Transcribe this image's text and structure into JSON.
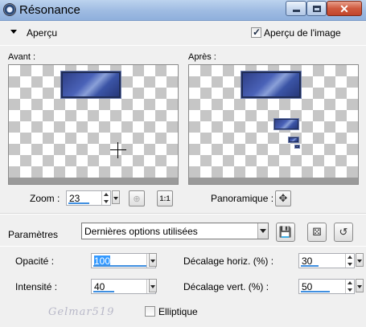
{
  "window": {
    "title": "Résonance"
  },
  "apercu": {
    "label": "Aperçu",
    "image_label": "Aperçu de l'image",
    "image_checked": true
  },
  "preview": {
    "avant_label": "Avant :",
    "apres_label": "Après :"
  },
  "zoom": {
    "label": "Zoom :",
    "value": "23"
  },
  "pan": {
    "label": "Panoramique :"
  },
  "params": {
    "label": "Paramètres",
    "preset": "Dernières options utilisées"
  },
  "fields": {
    "opacite": {
      "label": "Opacité :",
      "value": "100"
    },
    "intensite": {
      "label": "Intensité :",
      "value": "40"
    },
    "decal_h": {
      "label": "Décalage horiz. (%) :",
      "value": "30"
    },
    "decal_v": {
      "label": "Décalage vert. (%) :",
      "value": "50"
    }
  },
  "elliptique": {
    "label": "Elliptique",
    "checked": false
  },
  "watermark": "Gelmar519"
}
